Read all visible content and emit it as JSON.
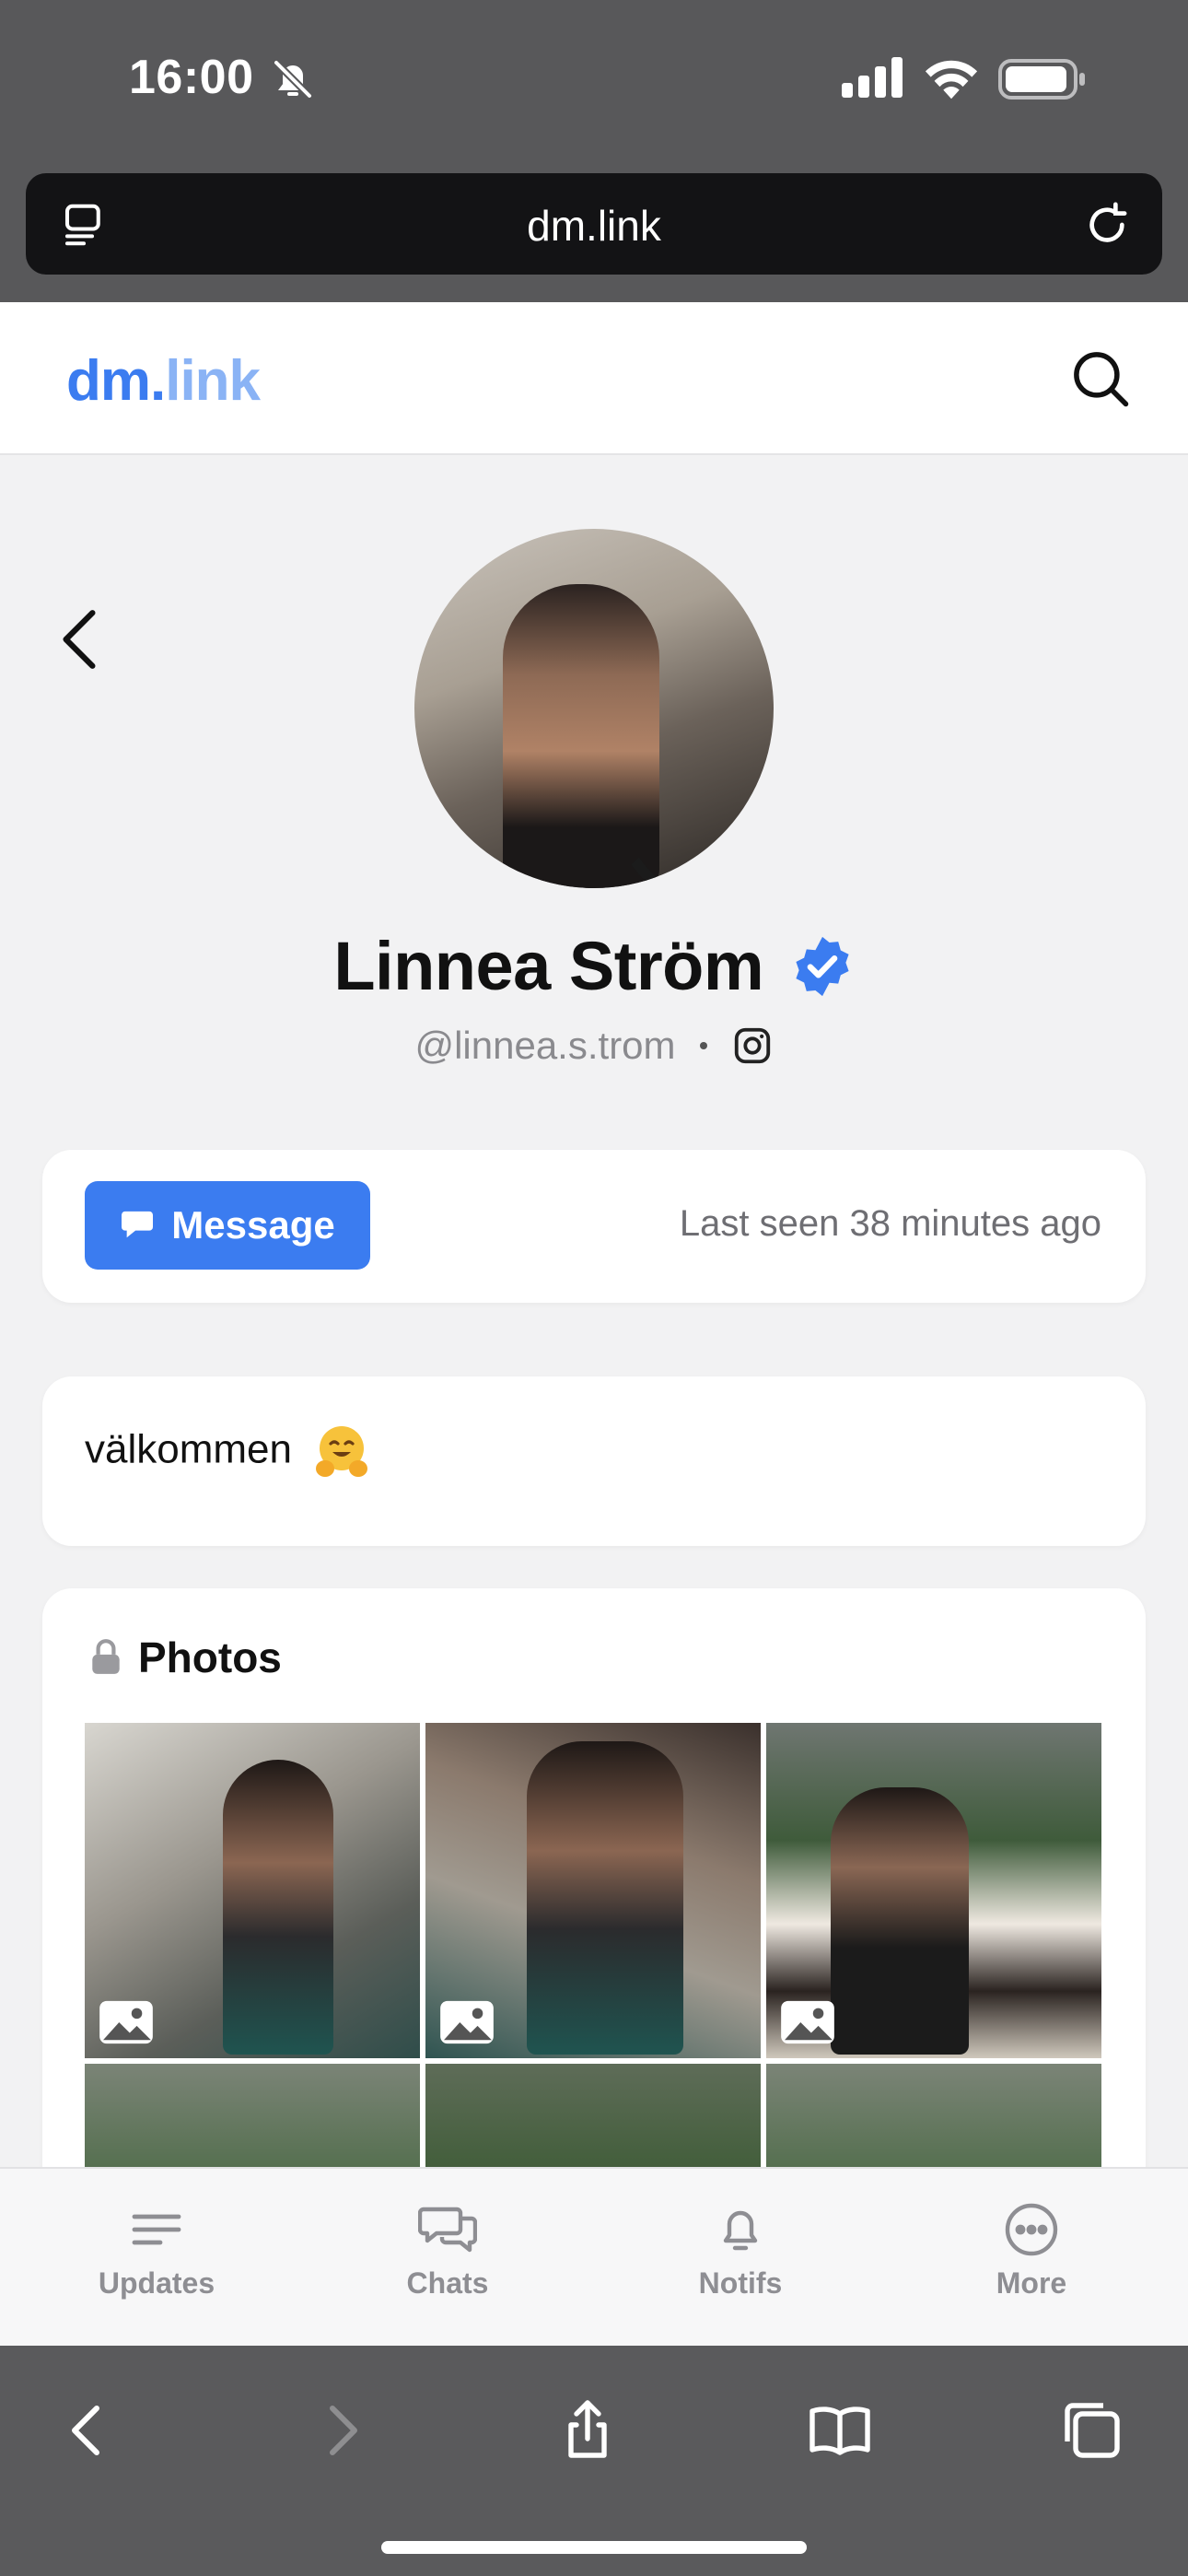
{
  "status_bar": {
    "time": "16:00"
  },
  "browser": {
    "url": "dm.link"
  },
  "site": {
    "logo_part1": "dm.",
    "logo_part2": "link"
  },
  "profile": {
    "name": "Linnea Ström",
    "handle": "@linnea.s.trom",
    "verified": true
  },
  "actions": {
    "message_label": "Message",
    "last_seen": "Last seen 38 minutes ago"
  },
  "bio": {
    "text": "välkommen"
  },
  "photos": {
    "title": "Photos",
    "tile_count_visible": 6
  },
  "tabbar": {
    "items": [
      {
        "label": "Updates",
        "icon": "menu-lines-icon"
      },
      {
        "label": "Chats",
        "icon": "chat-bubbles-icon"
      },
      {
        "label": "Notifs",
        "icon": "bell-icon"
      },
      {
        "label": "More",
        "icon": "more-dots-icon"
      }
    ]
  },
  "colors": {
    "accent": "#3b7cf0",
    "logo_light": "#8ab3f5",
    "muted": "#6e6e73"
  }
}
